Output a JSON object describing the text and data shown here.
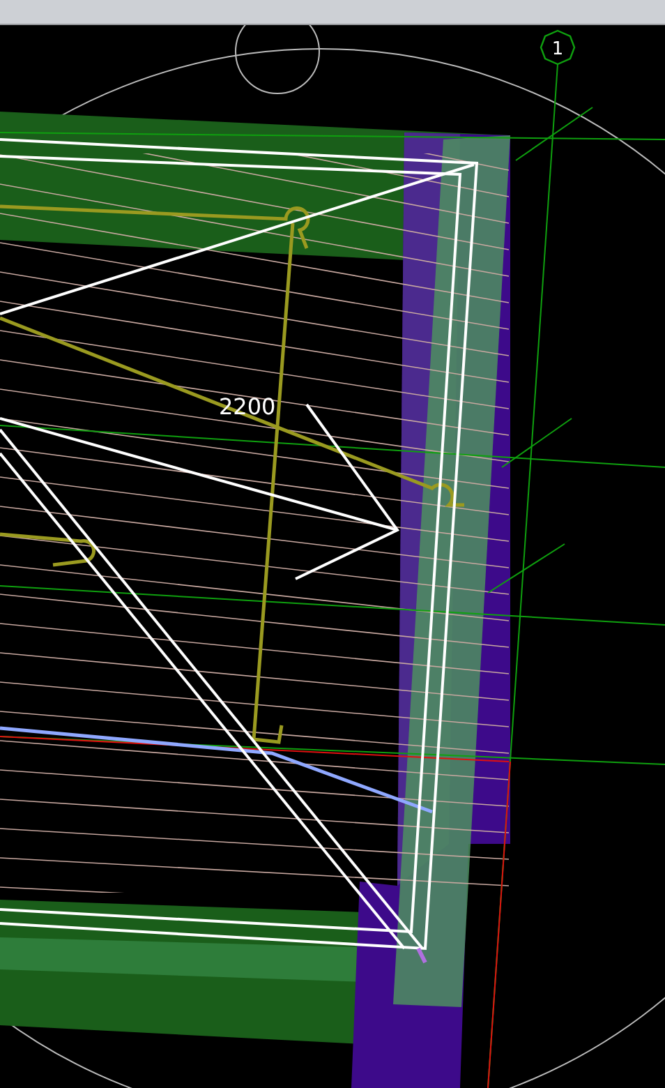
{
  "viewport": {
    "grid_label": "1",
    "dimension": "2200"
  }
}
